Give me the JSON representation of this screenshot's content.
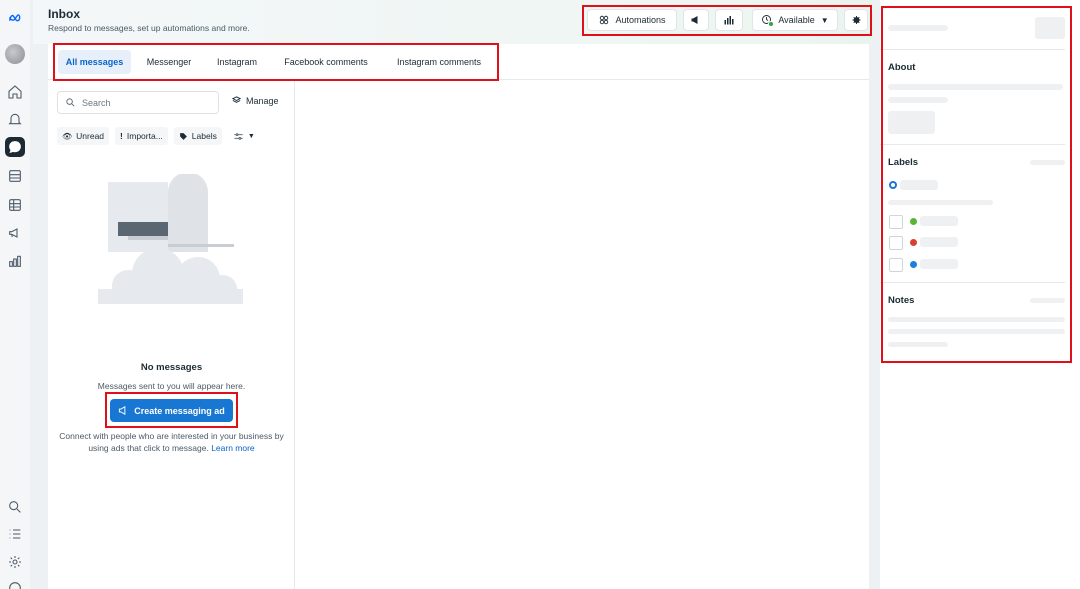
{
  "header": {
    "title": "Inbox",
    "subtitle": "Respond to messages, set up automations and more."
  },
  "toolbar": {
    "automations_label": "Automations",
    "availability_label": "Available",
    "icons": [
      "automations-icon",
      "megaphone-icon",
      "bar-chart-icon",
      "availability-icon",
      "chevron-down-icon",
      "gear-icon"
    ]
  },
  "tabs": [
    {
      "label": "All messages",
      "active": true
    },
    {
      "label": "Messenger",
      "active": false
    },
    {
      "label": "Instagram",
      "active": false
    },
    {
      "label": "Facebook comments",
      "active": false
    },
    {
      "label": "Instagram comments",
      "active": false
    }
  ],
  "list": {
    "search_placeholder": "Search",
    "manage_label": "Manage",
    "filters": [
      {
        "label": "Unread",
        "icon": "eye-icon"
      },
      {
        "label": "Importa...",
        "icon": "exclamation-icon"
      },
      {
        "label": "Labels",
        "icon": "tag-icon"
      }
    ]
  },
  "empty_state": {
    "title": "No messages",
    "subtitle": "Messages sent to you will appear here.",
    "cta_label": "Create messaging ad",
    "description": "Connect with people who are interested in your business by using ads that click to message.",
    "learn_more": "Learn more"
  },
  "right_panel": {
    "about_title": "About",
    "labels_title": "Labels",
    "notes_title": "Notes",
    "label_dot_colors": [
      "#5ab532",
      "#d9412f",
      "#1f7fe0"
    ]
  },
  "rail_icons": [
    "meta-logo",
    "profile-avatar",
    "home-icon",
    "bell-icon",
    "inbox-icon",
    "content-icon",
    "table-icon",
    "ads-icon",
    "insights-icon",
    "search-icon",
    "list-icon",
    "settings-icon",
    "help-icon"
  ],
  "colors": {
    "accent": "#1877d2",
    "highlight": "#e0101a"
  }
}
